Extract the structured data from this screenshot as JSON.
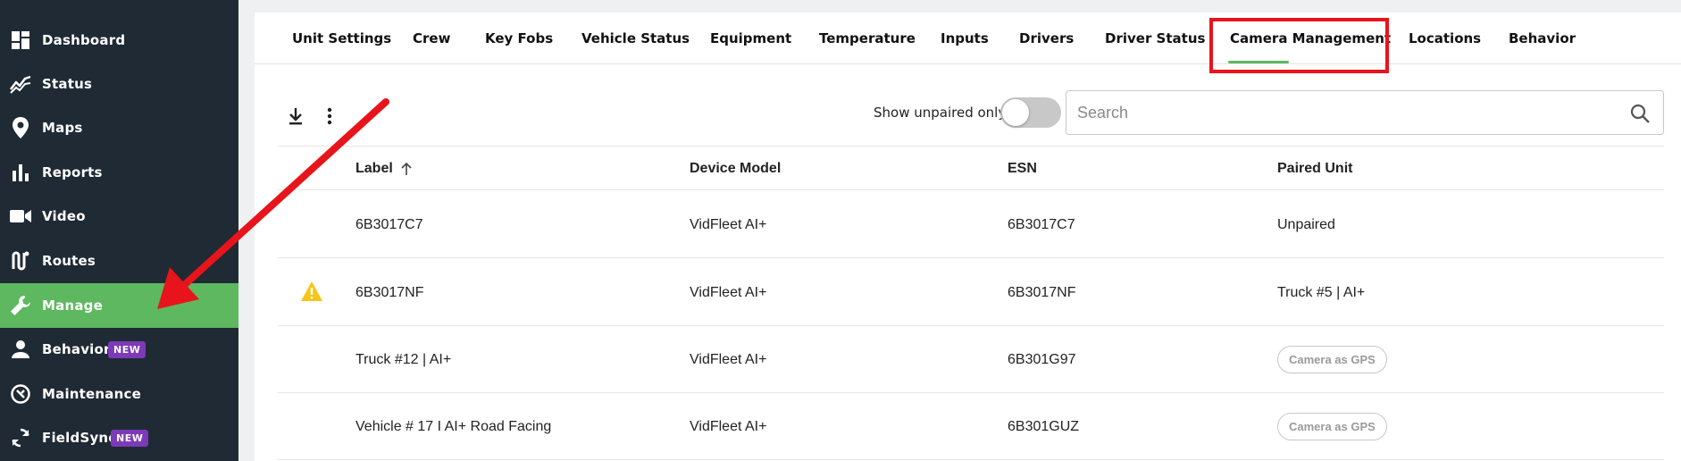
{
  "sidebar": {
    "items": [
      {
        "label": "Dashboard",
        "icon": "dashboard-icon"
      },
      {
        "label": "Status",
        "icon": "status-icon"
      },
      {
        "label": "Maps",
        "icon": "map-pin-icon"
      },
      {
        "label": "Reports",
        "icon": "bar-chart-icon"
      },
      {
        "label": "Video",
        "icon": "video-camera-icon"
      },
      {
        "label": "Routes",
        "icon": "route-icon"
      },
      {
        "label": "Manage",
        "icon": "wrench-icon"
      },
      {
        "label": "Behavior",
        "icon": "person-icon",
        "badge": "NEW"
      },
      {
        "label": "Maintenance",
        "icon": "maintenance-icon"
      },
      {
        "label": "FieldSync",
        "icon": "sync-icon",
        "badge": "NEW"
      }
    ],
    "active": "Manage",
    "active_color": "#5db85f",
    "background": "#1f2a34",
    "badge_color": "#7c3ab8"
  },
  "tabs": [
    {
      "label": "Unit Settings"
    },
    {
      "label": "Crew"
    },
    {
      "label": "Key Fobs"
    },
    {
      "label": "Vehicle Status"
    },
    {
      "label": "Equipment"
    },
    {
      "label": "Temperature"
    },
    {
      "label": "Inputs"
    },
    {
      "label": "Drivers"
    },
    {
      "label": "Driver Status"
    },
    {
      "label": "Camera Management"
    },
    {
      "label": "Locations"
    },
    {
      "label": "Behavior"
    }
  ],
  "active_tab": "Camera Management",
  "toolbar": {
    "download_icon": "download-icon",
    "more_icon": "more-vertical-icon",
    "toggle_label": "Show unpaired only",
    "toggle_on": false,
    "search_placeholder": "Search",
    "search_value": ""
  },
  "table": {
    "columns": [
      "Label",
      "Device Model",
      "ESN",
      "Paired Unit"
    ],
    "sort_column": "Label",
    "sort_direction": "ascending",
    "rows": [
      {
        "warning": false,
        "label": "6B3017C7",
        "device_model": "VidFleet AI+",
        "esn": "6B3017C7",
        "paired_unit": "Unpaired",
        "paired_type": "text"
      },
      {
        "warning": true,
        "label": "6B3017NF",
        "device_model": "VidFleet AI+",
        "esn": "6B3017NF",
        "paired_unit": "Truck #5 | AI+",
        "paired_type": "text"
      },
      {
        "warning": false,
        "label": "Truck #12 | AI+",
        "device_model": "VidFleet AI+",
        "esn": "6B301G97",
        "paired_unit": "Camera as GPS",
        "paired_type": "pill"
      },
      {
        "warning": false,
        "label": "Vehicle # 17 I AI+ Road Facing",
        "device_model": "VidFleet AI+",
        "esn": "6B301GUZ",
        "paired_unit": "Camera as GPS",
        "paired_type": "pill"
      }
    ]
  },
  "annotations": {
    "highlight_color": "#e8141b",
    "arrow_color": "#e8141b"
  }
}
